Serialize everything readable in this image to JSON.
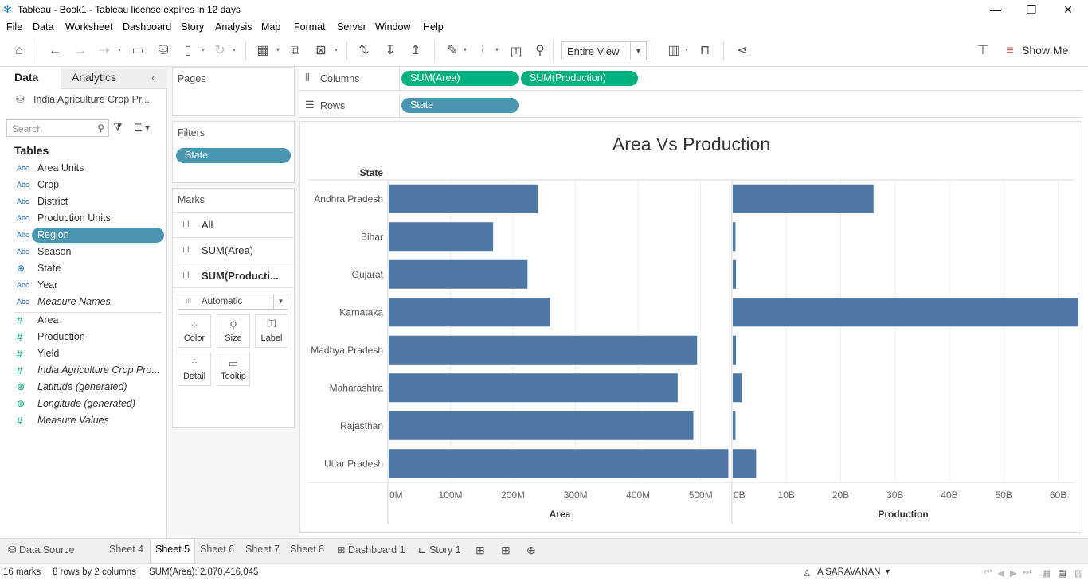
{
  "window": {
    "title": "Tableau - Book1 - Tableau license expires in 12 days"
  },
  "menu": [
    "File",
    "Data",
    "Worksheet",
    "Dashboard",
    "Story",
    "Analysis",
    "Map",
    "Format",
    "Server",
    "Window",
    "Help"
  ],
  "toolbar": {
    "fit_label": "Entire View",
    "show_me": "Show Me"
  },
  "data_pane": {
    "tab_data": "Data",
    "tab_analytics": "Analytics",
    "datasource": "India Agriculture Crop Pr...",
    "search_placeholder": "Search",
    "tables_header": "Tables",
    "dimensions": [
      {
        "type": "Abc",
        "name": "Area Units"
      },
      {
        "type": "Abc",
        "name": "Crop"
      },
      {
        "type": "Abc",
        "name": "District"
      },
      {
        "type": "Abc",
        "name": "Production Units"
      },
      {
        "type": "Abc",
        "name": "Region"
      },
      {
        "type": "Abc",
        "name": "Season"
      },
      {
        "type": "globe",
        "name": "State"
      },
      {
        "type": "Abc",
        "name": "Year"
      },
      {
        "type": "Abc",
        "name": "Measure Names"
      }
    ],
    "measures": [
      {
        "type": "#",
        "name": "Area"
      },
      {
        "type": "#",
        "name": "Production"
      },
      {
        "type": "#",
        "name": "Yield"
      },
      {
        "type": "#",
        "name": "India Agriculture Crop Pro..."
      },
      {
        "type": "globe",
        "name": "Latitude (generated)"
      },
      {
        "type": "globe",
        "name": "Longitude (generated)"
      },
      {
        "type": "#",
        "name": "Measure Values"
      }
    ]
  },
  "pages": {
    "title": "Pages"
  },
  "filters": {
    "title": "Filters",
    "pill": "State"
  },
  "marks": {
    "title": "Marks",
    "rows": [
      "All",
      "SUM(Area)",
      "SUM(Producti..."
    ],
    "type": "Automatic",
    "buttons": [
      "Color",
      "Size",
      "Label",
      "Detail",
      "Tooltip"
    ]
  },
  "shelves": {
    "columns_label": "Columns",
    "columns_pills": [
      "SUM(Area)",
      "SUM(Production)"
    ],
    "rows_label": "Rows",
    "rows_pills": [
      "State"
    ]
  },
  "chart_data": {
    "type": "bar",
    "title": "Area Vs Production",
    "row_header": "State",
    "categories": [
      "Andhra Pradesh",
      "Bihar",
      "Gujarat",
      "Karnataka",
      "Madhya Pradesh",
      "Maharashtra",
      "Rajasthan",
      "Uttar Pradesh"
    ],
    "panes": [
      {
        "name": "Area",
        "ticks": [
          "0M",
          "100M",
          "200M",
          "300M",
          "400M",
          "500M"
        ],
        "tick_values": [
          0,
          100,
          200,
          300,
          400,
          500
        ],
        "xlim": [
          0,
          550
        ],
        "values": [
          238,
          167,
          222,
          258,
          493,
          462,
          487,
          543
        ]
      },
      {
        "name": "Production",
        "ticks": [
          "0B",
          "10B",
          "20B",
          "30B",
          "40B",
          "50B",
          "60B"
        ],
        "tick_values": [
          0,
          10,
          20,
          30,
          40,
          50,
          60
        ],
        "xlim": [
          0,
          63
        ],
        "values": [
          25.9,
          0.5,
          0.6,
          63.6,
          0.6,
          1.7,
          0.5,
          4.3
        ]
      }
    ],
    "bar_color": "#4e79a7",
    "grid": true
  },
  "sheet_tabs": [
    "Data Source",
    "Sheet 4",
    "Sheet 5",
    "Sheet 6",
    "Sheet 7",
    "Sheet 8",
    "Dashboard 1",
    "Story 1"
  ],
  "status": {
    "marks": "16 marks",
    "dims": "8 rows by 2 columns",
    "sum": "SUM(Area): 2,870,416,045",
    "user": "A SARAVANAN"
  }
}
